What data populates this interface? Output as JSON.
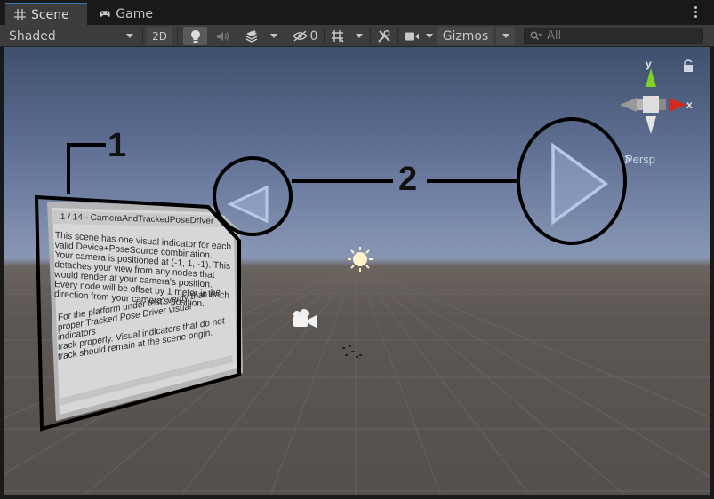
{
  "tabs": [
    {
      "label": "Scene",
      "icon": "grid-icon",
      "active": true
    },
    {
      "label": "Game",
      "icon": "gamepad-icon",
      "active": false
    }
  ],
  "toolbar": {
    "draw_mode": "Shaded",
    "mode_2d": "2D",
    "hidden_count": "0",
    "gizmos": "Gizmos",
    "search_placeholder": "All"
  },
  "scene": {
    "orientation_y": "y",
    "orientation_x": "x",
    "projection": "Persp",
    "annotation_1": "1",
    "annotation_2": "2",
    "panel": {
      "header": "1 / 14 - CameraAndTrackedPoseDriver",
      "paragraph1": [
        "This scene has one visual indicator for each",
        "valid Device+PoseSource combination.",
        "Your camera is positioned at (-1, 1, -1). This",
        "detaches your view from any nodes that",
        "would render at your camera's position.",
        "Every node will be offset by 1 meter in each",
        "direction from your camera's position."
      ],
      "paragraph2": [
        "For the platform under test, verify that the",
        "proper Tracked Pose Driver visual indicators",
        "track properly.  Visual indicators that do not",
        "track should remain at the scene origin."
      ]
    }
  }
}
